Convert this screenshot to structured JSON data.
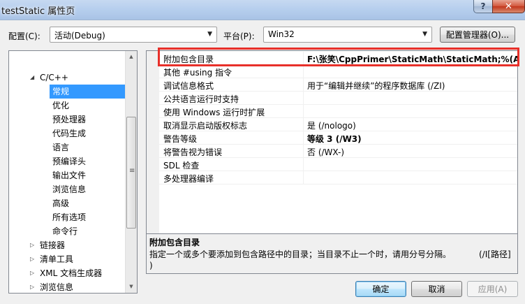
{
  "window": {
    "title": "testStatic 属性页",
    "help_glyph": "?",
    "close_glyph": "✕"
  },
  "toolbar": {
    "config_label": "配置(C):",
    "config_value": "活动(Debug)",
    "platform_label": "平台(P):",
    "platform_value": "Win32",
    "config_manager_label": "配置管理器(O)..."
  },
  "tree": {
    "items": [
      {
        "label": "C/C++",
        "expanded": true
      },
      {
        "label": "常规",
        "selected": true
      },
      {
        "label": "优化"
      },
      {
        "label": "预处理器"
      },
      {
        "label": "代码生成"
      },
      {
        "label": "语言"
      },
      {
        "label": "预编译头"
      },
      {
        "label": "输出文件"
      },
      {
        "label": "浏览信息"
      },
      {
        "label": "高级"
      },
      {
        "label": "所有选项"
      },
      {
        "label": "命令行"
      },
      {
        "label": "链接器",
        "expanded": false
      },
      {
        "label": "清单工具",
        "expanded": false
      },
      {
        "label": "XML 文档生成器",
        "expanded": false
      },
      {
        "label": "浏览信息",
        "expanded": false
      }
    ]
  },
  "properties": [
    {
      "name": "附加包含目录",
      "value": "F:\\张笑\\CppPrimer\\StaticMath\\StaticMath;%(Addi",
      "bold": true
    },
    {
      "name": "其他 #using 指令",
      "value": ""
    },
    {
      "name": "调试信息格式",
      "value": "用于“编辑并继续”的程序数据库 (/ZI)"
    },
    {
      "name": "公共语言运行时支持",
      "value": ""
    },
    {
      "name": "使用 Windows 运行时扩展",
      "value": ""
    },
    {
      "name": "取消显示启动版权标志",
      "value": "是 (/nologo)"
    },
    {
      "name": "警告等级",
      "value": "等级 3 (/W3)",
      "bold": true
    },
    {
      "name": "将警告视为错误",
      "value": "否 (/WX-)"
    },
    {
      "name": "SDL 检查",
      "value": ""
    },
    {
      "name": "多处理器编译",
      "value": ""
    }
  ],
  "description": {
    "title": "附加包含目录",
    "text": "指定一个或多个要添加到包含路径中的目录；当目录不止一个时，请用分号分隔。",
    "switch": "(/I[路径]",
    "switch_tail": ")"
  },
  "buttons": {
    "ok": "确定",
    "cancel": "取消",
    "apply": "应用(A)"
  },
  "colors": {
    "selection": "#3399ff",
    "highlight_box": "#e8302a"
  }
}
